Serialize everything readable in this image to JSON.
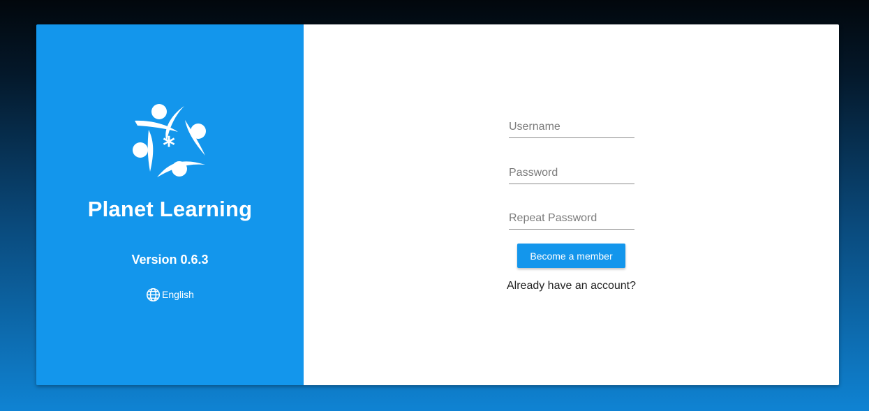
{
  "brand": {
    "logo_icon": "planet-learning-logo-icon",
    "title": "Planet Learning",
    "version": "Version 0.6.3",
    "language_icon": "globe-icon",
    "language": "English",
    "panel_color": "#1396ec"
  },
  "form": {
    "username_placeholder": "Username",
    "password_placeholder": "Password",
    "repeat_password_placeholder": "Repeat Password",
    "submit_label": "Become a member",
    "login_link": "Already have an account?"
  }
}
